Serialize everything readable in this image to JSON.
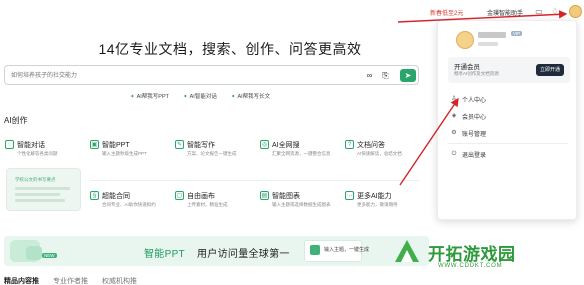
{
  "topbar": {
    "promo": "新春低至2元",
    "assistant": "金璞智能助手",
    "icons": [
      "folder-icon",
      "bell-icon",
      "user-avatar"
    ]
  },
  "hero": {
    "headline": "14亿专业文档，搜索、创作、问答更高效",
    "search_placeholder": "如何培养孩子的社交能力",
    "quick_links": [
      "AI帮我写PPT",
      "AI智能对话",
      "AI帮我写长文"
    ]
  },
  "ai_section": {
    "title": "AI创作",
    "cards": [
      {
        "title": "智能对话",
        "desc": "个性化解答各类问题",
        "icon": "chat-icon"
      },
      {
        "title": "智能PPT",
        "desc": "输入主题秒级生成PPT",
        "icon": "ppt-icon"
      },
      {
        "title": "智能写作",
        "desc": "方案、论文报告一键生成",
        "icon": "pen-icon"
      },
      {
        "title": "AI全网搜",
        "desc": "汇聚全网资源，一键整合信息",
        "icon": "globe-search-icon"
      },
      {
        "title": "文档问答",
        "desc": "AI快速解读，总结文档",
        "icon": "doc-qa-icon"
      },
      {
        "title": "超能合同",
        "desc": "合同专业、AI助你快速拟约",
        "icon": "contract-icon"
      },
      {
        "title": "自由画布",
        "desc": "上传素材，精准生成",
        "icon": "canvas-icon"
      },
      {
        "title": "智能图表",
        "desc": "输入主题或选择数据生成图表",
        "icon": "chart-icon"
      },
      {
        "title": "更多AI能力",
        "desc": "更多能力，敬请期待",
        "icon": "more-icon"
      }
    ],
    "thumb_text": "学校公文的书写要点"
  },
  "banner": {
    "title_green": "智能PPT",
    "title_dark": "用户访问量全球第一",
    "badge": "NEW",
    "mini_card": "输入主题，一键生成"
  },
  "tabs": [
    "精品内容推",
    "专业作者推",
    "权威机构推"
  ],
  "panel": {
    "tag": "VIP",
    "member_title": "开通会员",
    "member_desc": "畅享AI创作及文档资源",
    "member_button": "立即开通",
    "menu": [
      {
        "label": "个人中心",
        "icon": "user-icon"
      },
      {
        "label": "会员中心",
        "icon": "vip-icon"
      },
      {
        "label": "账号管理",
        "icon": "gear-icon"
      },
      {
        "label": "退出登录",
        "icon": "logout-icon"
      }
    ]
  },
  "watermark": {
    "text": "开拓游戏园",
    "url": "WWW.CDDKT.COM"
  },
  "colors": {
    "accent_green": "#2aa66a",
    "arrow_red": "#d4242a",
    "promo_red": "#d43a2f",
    "watermark_green": "#2e9a3c"
  }
}
